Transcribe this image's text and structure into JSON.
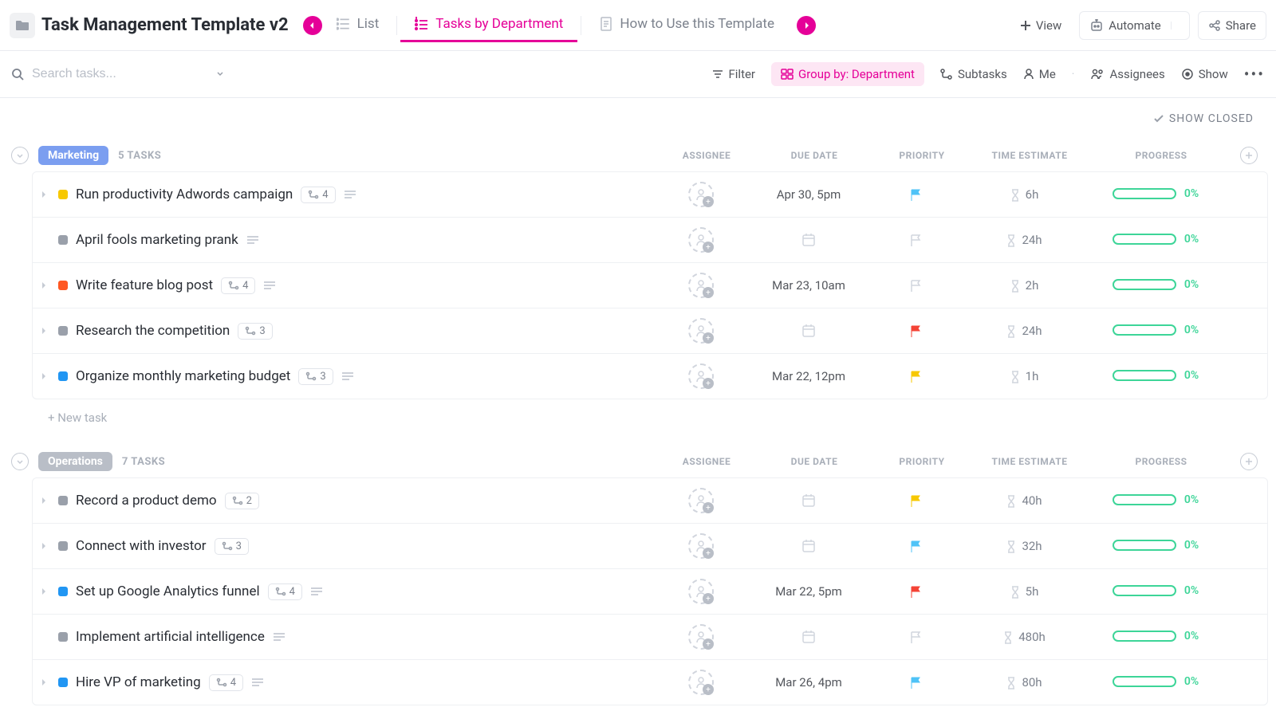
{
  "header": {
    "title": "Task Management Template v2",
    "tabs": [
      {
        "label": "List",
        "active": false
      },
      {
        "label": "Tasks by Department",
        "active": true
      },
      {
        "label": "How to Use this Template",
        "active": false
      }
    ],
    "view_btn": "View",
    "automate_btn": "Automate",
    "share_btn": "Share"
  },
  "toolbar": {
    "search_placeholder": "Search tasks...",
    "filter": "Filter",
    "group_by": "Group by: Department",
    "subtasks": "Subtasks",
    "me": "Me",
    "assignees": "Assignees",
    "show": "Show"
  },
  "show_closed": "SHOW CLOSED",
  "columns": {
    "assignee": "ASSIGNEE",
    "due": "DUE DATE",
    "priority": "PRIORITY",
    "time": "TIME ESTIMATE",
    "progress": "PROGRESS"
  },
  "groups": [
    {
      "name": "Marketing",
      "badge_class": "badge-marketing",
      "count_label": "5 TASKS",
      "tasks": [
        {
          "status_color": "#f7c800",
          "name": "Run productivity Adwords campaign",
          "subtasks": "4",
          "has_desc": true,
          "due": "Apr 30, 5pm",
          "flag_color": "#4fc3f7",
          "flag_muted": false,
          "time": "6h",
          "progress": "0%",
          "has_caret": true
        },
        {
          "status_color": "#9aa0aa",
          "name": "April fools marketing prank",
          "subtasks": null,
          "has_desc": true,
          "due": null,
          "flag_color": "#d1d5dd",
          "flag_muted": true,
          "time": "24h",
          "progress": "0%",
          "has_caret": false
        },
        {
          "status_color": "#ff5722",
          "name": "Write feature blog post",
          "subtasks": "4",
          "has_desc": true,
          "due": "Mar 23, 10am",
          "flag_color": "#d1d5dd",
          "flag_muted": true,
          "time": "2h",
          "progress": "0%",
          "has_caret": true
        },
        {
          "status_color": "#9aa0aa",
          "name": "Research the competition",
          "subtasks": "3",
          "has_desc": false,
          "due": null,
          "flag_color": "#f44336",
          "flag_muted": false,
          "time": "24h",
          "progress": "0%",
          "has_caret": true
        },
        {
          "status_color": "#2196f3",
          "name": "Organize monthly marketing budget",
          "subtasks": "3",
          "has_desc": true,
          "due": "Mar 22, 12pm",
          "flag_color": "#f7c800",
          "flag_muted": false,
          "time": "1h",
          "progress": "0%",
          "has_caret": true
        }
      ],
      "new_task": "+ New task"
    },
    {
      "name": "Operations",
      "badge_class": "badge-operations",
      "count_label": "7 TASKS",
      "tasks": [
        {
          "status_color": "#9aa0aa",
          "name": "Record a product demo",
          "subtasks": "2",
          "has_desc": false,
          "due": null,
          "flag_color": "#f7c800",
          "flag_muted": false,
          "time": "40h",
          "progress": "0%",
          "has_caret": true
        },
        {
          "status_color": "#9aa0aa",
          "name": "Connect with investor",
          "subtasks": "3",
          "has_desc": false,
          "due": null,
          "flag_color": "#4fc3f7",
          "flag_muted": false,
          "time": "32h",
          "progress": "0%",
          "has_caret": true
        },
        {
          "status_color": "#2196f3",
          "name": "Set up Google Analytics funnel",
          "subtasks": "4",
          "has_desc": true,
          "due": "Mar 22, 5pm",
          "flag_color": "#f44336",
          "flag_muted": false,
          "time": "5h",
          "progress": "0%",
          "has_caret": true
        },
        {
          "status_color": "#9aa0aa",
          "name": "Implement artificial intelligence",
          "subtasks": null,
          "has_desc": true,
          "due": null,
          "flag_color": "#d1d5dd",
          "flag_muted": true,
          "time": "480h",
          "progress": "0%",
          "has_caret": false
        },
        {
          "status_color": "#2196f3",
          "name": "Hire VP of marketing",
          "subtasks": "4",
          "has_desc": true,
          "due": "Mar 26, 4pm",
          "flag_color": "#4fc3f7",
          "flag_muted": false,
          "time": "80h",
          "progress": "0%",
          "has_caret": true
        }
      ]
    }
  ]
}
